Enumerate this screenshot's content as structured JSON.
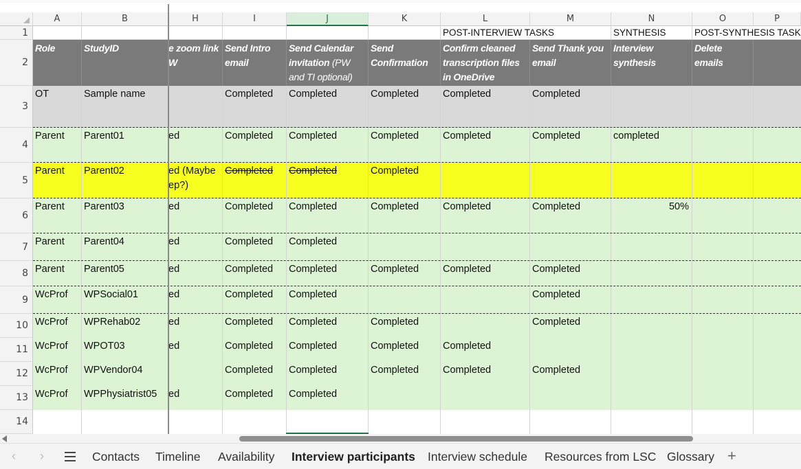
{
  "columns": [
    "A",
    "B",
    "H",
    "I",
    "J",
    "K",
    "L",
    "M",
    "N",
    "O",
    "P"
  ],
  "row_numbers": [
    "1",
    "2",
    "3",
    "4",
    "5",
    "6",
    "7",
    "8",
    "9",
    "10",
    "11",
    "12",
    "13",
    "14"
  ],
  "row1": {
    "L": "POST-INTERVIEW TASKS",
    "N": "SYNTHESIS",
    "O": "POST-SYNTHESIS TASKS"
  },
  "headers": {
    "A": "Role",
    "B": "StudyID",
    "H": "e zoom link W",
    "I": "Send Intro email",
    "J_main": "Send Calendar invitation",
    "J_sub": " (PW and TI optional)",
    "K": "Send Confirmation",
    "L": "Confirm cleaned transcription files in OneDrive",
    "M": "Send Thank you email",
    "N": "Interview synthesis",
    "O": "Delete emails"
  },
  "rows": [
    {
      "A": "OT",
      "B": "Sample name",
      "H": "",
      "I": "Completed",
      "J": "Completed",
      "K": "Completed",
      "L": "Completed",
      "M": "Completed",
      "N": "",
      "O": ""
    },
    {
      "A": "Parent",
      "B": "Parent01",
      "H": "ed",
      "I": "Completed",
      "J": "Completed",
      "K": "Completed",
      "L": "Completed",
      "M": "Completed",
      "N": "completed",
      "O": ""
    },
    {
      "A": "Parent",
      "B": "Parent02",
      "H": "ed (Maybe ep?)",
      "I": "Completed",
      "J": "Completed",
      "K": "Completed",
      "L": "",
      "M": "",
      "N": "",
      "O": ""
    },
    {
      "A": "Parent",
      "B": "Parent03",
      "H": "ed",
      "I": "Completed",
      "J": "Completed",
      "K": "Completed",
      "L": "Completed",
      "M": "Completed",
      "N": "50%",
      "O": ""
    },
    {
      "A": "Parent",
      "B": "Parent04",
      "H": "ed",
      "I": "Completed",
      "J": "Completed",
      "K": "",
      "L": "",
      "M": "",
      "N": "",
      "O": ""
    },
    {
      "A": "Parent",
      "B": "Parent05",
      "H": "ed",
      "I": "Completed",
      "J": "Completed",
      "K": "Completed",
      "L": "Completed",
      "M": "Completed",
      "N": "",
      "O": ""
    },
    {
      "A": "WcProf",
      "B": "WPSocial01",
      "H": "ed",
      "I": "Completed",
      "J": "Completed",
      "K": "",
      "L": "",
      "M": "Completed",
      "N": "",
      "O": ""
    },
    {
      "A": "WcProf",
      "B": "WPRehab02",
      "H": "ed",
      "I": "Completed",
      "J": "Completed",
      "K": "Completed",
      "L": "",
      "M": "Completed",
      "N": "",
      "O": ""
    },
    {
      "A": "WcProf",
      "B": "WPOT03",
      "H": "ed",
      "I": "Completed",
      "J": "Completed",
      "K": "Completed",
      "L": "Completed",
      "M": "",
      "N": "",
      "O": ""
    },
    {
      "A": "WcProf",
      "B": "WPVendor04",
      "H": "",
      "I": "Completed",
      "J": "Completed",
      "K": "Completed",
      "L": "Completed",
      "M": "Completed",
      "N": "",
      "O": ""
    },
    {
      "A": "WcProf",
      "B": "WPPhysiatrist05",
      "H": "ed",
      "I": "Completed",
      "J": "Completed",
      "K": "",
      "L": "",
      "M": "",
      "N": "",
      "O": ""
    }
  ],
  "colors": {
    "header_gray": "#7a7a7a",
    "sample_gray": "#d9d9d9",
    "light_green": "#dcf3d4",
    "yellow": "#f7ff1f",
    "selected_green": "#217346"
  },
  "tabs": [
    "Contacts",
    "Timeline",
    "Availability",
    "Interview participants",
    "Interview schedule",
    "Resources from LSC",
    "Glossary"
  ],
  "active_tab": "Interview participants",
  "icons": {
    "prev": "chevron-left-icon",
    "next": "chevron-right-icon",
    "menu": "hamburger-menu-icon",
    "add": "plus-icon"
  }
}
